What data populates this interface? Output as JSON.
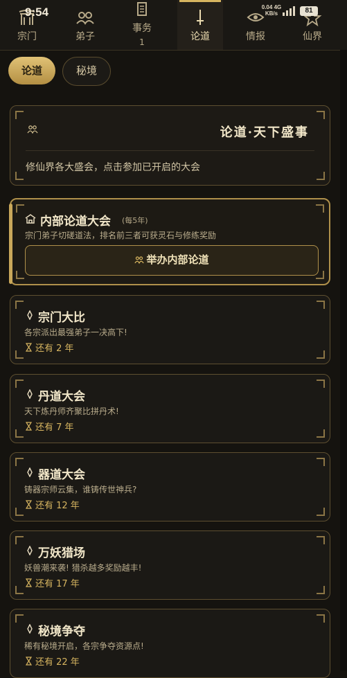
{
  "status_bar": {
    "time": "9:54",
    "net_speed": "0.04",
    "net_unit": "KB/s",
    "net_type": "4G",
    "battery": "81"
  },
  "nav": {
    "items": [
      {
        "label": "宗门",
        "icon": "sect-gate-icon"
      },
      {
        "label": "弟子",
        "icon": "disciples-icon"
      },
      {
        "label": "事务",
        "icon": "scroll-icon",
        "badge": "1"
      },
      {
        "label": "论道",
        "icon": "sword-icon",
        "active": true
      },
      {
        "label": "情报",
        "icon": "eye-icon"
      },
      {
        "label": "仙界",
        "icon": "star-icon"
      }
    ]
  },
  "tabs": {
    "active": "论道",
    "inactive": "秘境"
  },
  "hero": {
    "title": "论道·天下盛事",
    "description": "修仙界各大盛会，点击参加已开启的大会"
  },
  "inner_conference": {
    "title": "内部论道大会",
    "frequency": "(每5年)",
    "description": "宗门弟子切磋道法，排名前三者可获灵石与修练奖励",
    "button_label": "举办内部论道"
  },
  "events": [
    {
      "title": "宗门大比",
      "description": "各宗派出最强弟子一决高下!",
      "remaining": "还有 2 年"
    },
    {
      "title": "丹道大会",
      "description": "天下炼丹师齐聚比拼丹术!",
      "remaining": "还有 7 年"
    },
    {
      "title": "器道大会",
      "description": "铸器宗师云集，谁铸传世神兵?",
      "remaining": "还有 12 年"
    },
    {
      "title": "万妖猎场",
      "description": "妖兽潮来袭! 猎杀越多奖励越丰!",
      "remaining": "还有 17 年"
    },
    {
      "title": "秘境争夺",
      "description": "稀有秘境开启，各宗争夺资源点!",
      "remaining": "还有 22 年"
    }
  ],
  "colors": {
    "background": "#15130f",
    "accent_gold": "#d7b560",
    "card_border": "#5e4f30",
    "text_primary": "#f2e7c9"
  }
}
